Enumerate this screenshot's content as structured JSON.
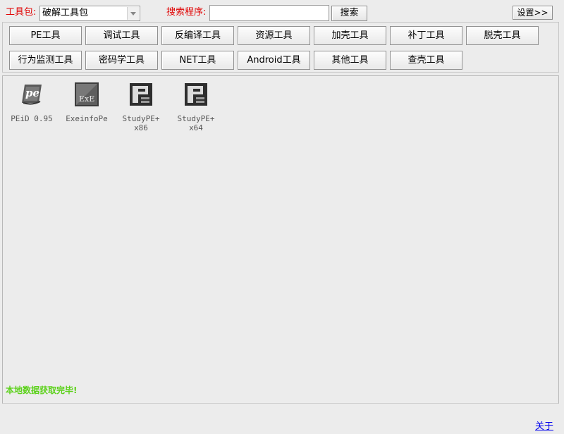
{
  "toolbar": {
    "toolkit_label": "工具包:",
    "toolkit_selected": "破解工具包",
    "search_label": "搜索程序:",
    "search_value": "",
    "search_button": "搜索",
    "settings_button": "设置>>"
  },
  "categories": [
    {
      "label": "PE工具"
    },
    {
      "label": "调试工具"
    },
    {
      "label": "反编译工具"
    },
    {
      "label": "资源工具"
    },
    {
      "label": "加壳工具"
    },
    {
      "label": "补丁工具"
    },
    {
      "label": "脱壳工具"
    },
    {
      "label": "行为监测工具"
    },
    {
      "label": "密码学工具"
    },
    {
      "label": "NET工具"
    },
    {
      "label": "Android工具"
    },
    {
      "label": "其他工具"
    },
    {
      "label": "查壳工具"
    }
  ],
  "tools": [
    {
      "name": "PEiD 0.95",
      "icon": "peid-icon"
    },
    {
      "name": "ExeinfoPe",
      "icon": "exeinfope-icon"
    },
    {
      "name": "StudyPE+\nx86",
      "line1": "StudyPE+",
      "line2": "x86",
      "icon": "studype-icon"
    },
    {
      "name": "StudyPE+\nx64",
      "line1": "StudyPE+",
      "line2": "x64",
      "icon": "studype-icon"
    }
  ],
  "status": "本地数据获取完毕!",
  "footer": {
    "about": "关于"
  },
  "colors": {
    "label_red": "#e00000",
    "status_green": "#5bd119",
    "link_blue": "#0000ee"
  }
}
